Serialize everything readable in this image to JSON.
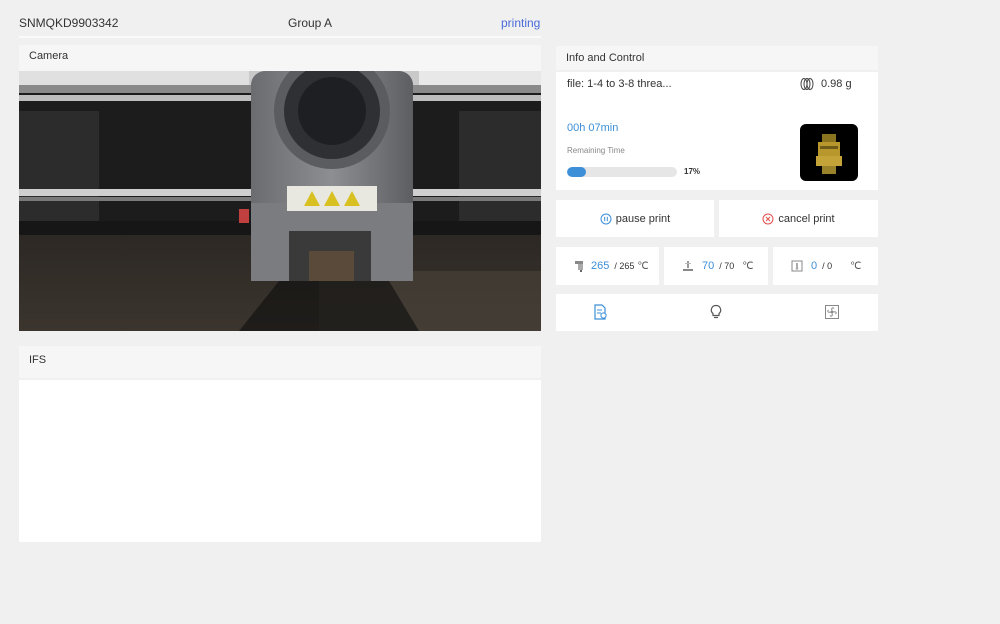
{
  "header": {
    "serial": "SNMQKD9903342",
    "group": "Group A",
    "status": "printing"
  },
  "camera": {
    "title": "Camera",
    "feed_icon": "printer-nozzle-camera-feed"
  },
  "ifs": {
    "title": "IFS"
  },
  "info": {
    "title": "Info and Control",
    "file": "file: 1-4 to 3-8 threa...",
    "weight_icon": "filament-spool-icon",
    "weight": "0.98 g",
    "time": "00h 07min",
    "time_label": "Remaining Time",
    "progress": 17,
    "progress_label": "17%",
    "thumbnail_icon": "model-thumbnail"
  },
  "controls": {
    "pause_label": "pause print",
    "cancel_label": "cancel print",
    "pause_color": "#3d8fd8",
    "cancel_color": "#e05050"
  },
  "temperatures": [
    {
      "icon": "nozzle-icon",
      "current": "265",
      "target": "/ 265",
      "unit": "℃"
    },
    {
      "icon": "bed-icon",
      "current": "70",
      "target": "/ 70",
      "unit": "℃"
    },
    {
      "icon": "chamber-icon",
      "current": "0",
      "target": "/ 0",
      "unit": "℃"
    }
  ],
  "tools": [
    {
      "icon": "file-settings-icon",
      "color": "#3d8fd8"
    },
    {
      "icon": "light-bulb-icon",
      "color": "#555555"
    },
    {
      "icon": "fan-icon",
      "color": "#888888"
    }
  ],
  "colors": {
    "accent": "#3d8fd8",
    "status": "#4a6ad8"
  }
}
